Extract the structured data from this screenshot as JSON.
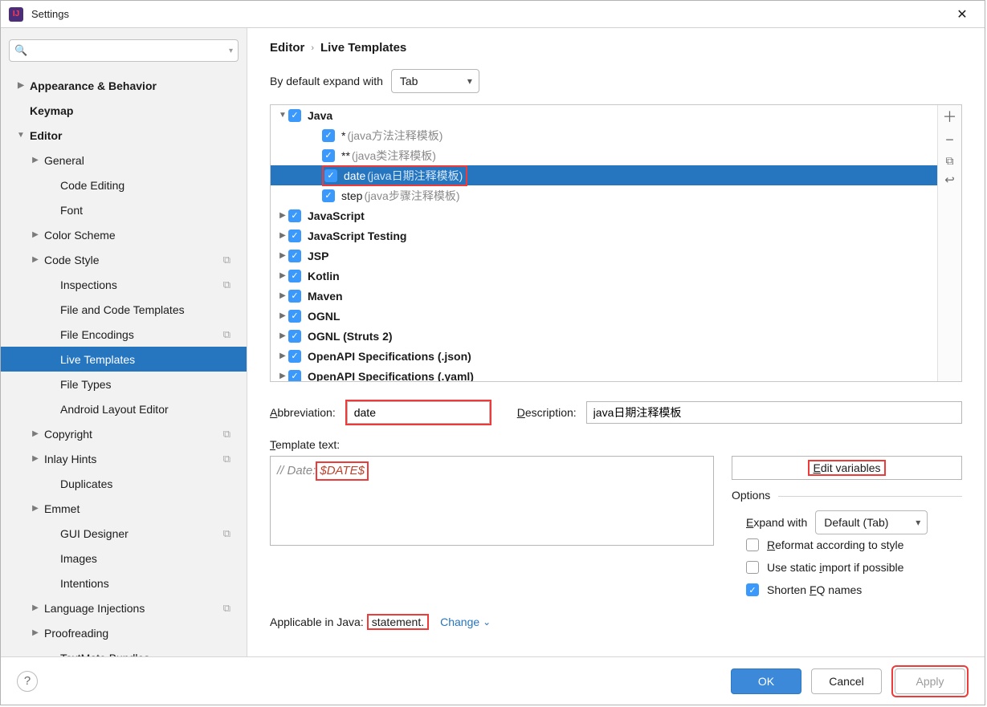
{
  "window": {
    "title": "Settings"
  },
  "search": {
    "placeholder": ""
  },
  "sidebar": {
    "items": [
      {
        "label": "Appearance & Behavior",
        "bold": true,
        "arrow": "▶",
        "ind": 0
      },
      {
        "label": "Keymap",
        "bold": true,
        "arrow": "",
        "ind": 0
      },
      {
        "label": "Editor",
        "bold": true,
        "arrow": "▼",
        "ind": 0
      },
      {
        "label": "General",
        "arrow": "▶",
        "ind": 1
      },
      {
        "label": "Code Editing",
        "arrow": "",
        "ind": 2
      },
      {
        "label": "Font",
        "arrow": "",
        "ind": 2
      },
      {
        "label": "Color Scheme",
        "arrow": "▶",
        "ind": 1
      },
      {
        "label": "Code Style",
        "arrow": "▶",
        "ind": 1,
        "copy": true
      },
      {
        "label": "Inspections",
        "arrow": "",
        "ind": 2,
        "copy": true
      },
      {
        "label": "File and Code Templates",
        "arrow": "",
        "ind": 2
      },
      {
        "label": "File Encodings",
        "arrow": "",
        "ind": 2,
        "copy": true
      },
      {
        "label": "Live Templates",
        "arrow": "",
        "ind": 2,
        "selected": true
      },
      {
        "label": "File Types",
        "arrow": "",
        "ind": 2
      },
      {
        "label": "Android Layout Editor",
        "arrow": "",
        "ind": 2
      },
      {
        "label": "Copyright",
        "arrow": "▶",
        "ind": 1,
        "copy": true
      },
      {
        "label": "Inlay Hints",
        "arrow": "▶",
        "ind": 1,
        "copy": true
      },
      {
        "label": "Duplicates",
        "arrow": "",
        "ind": 2
      },
      {
        "label": "Emmet",
        "arrow": "▶",
        "ind": 1
      },
      {
        "label": "GUI Designer",
        "arrow": "",
        "ind": 2,
        "copy": true
      },
      {
        "label": "Images",
        "arrow": "",
        "ind": 2
      },
      {
        "label": "Intentions",
        "arrow": "",
        "ind": 2
      },
      {
        "label": "Language Injections",
        "arrow": "▶",
        "ind": 1,
        "copy": true
      },
      {
        "label": "Proofreading",
        "arrow": "▶",
        "ind": 1
      },
      {
        "label": "TextMate Bundles",
        "arrow": "",
        "ind": 2
      }
    ]
  },
  "breadcrumb": {
    "a": "Editor",
    "b": "Live Templates"
  },
  "default_expand": {
    "label": "By default expand with",
    "value": "Tab"
  },
  "template_tree": [
    {
      "ind": 0,
      "arrow": "▼",
      "check": true,
      "label": "Java",
      "bold": true
    },
    {
      "ind": 2,
      "arrow": "",
      "check": true,
      "label": "*",
      "desc": "(java方法注释模板)"
    },
    {
      "ind": 2,
      "arrow": "",
      "check": true,
      "label": "**",
      "desc": "(java类注释模板)"
    },
    {
      "ind": 2,
      "arrow": "",
      "check": true,
      "label": "date",
      "desc": "(java日期注释模板)",
      "selected": true,
      "red": true
    },
    {
      "ind": 2,
      "arrow": "",
      "check": true,
      "label": "step",
      "desc": "(java步骤注释模板)"
    },
    {
      "ind": 0,
      "arrow": "▶",
      "check": true,
      "label": "JavaScript",
      "bold": true
    },
    {
      "ind": 0,
      "arrow": "▶",
      "check": true,
      "label": "JavaScript Testing",
      "bold": true
    },
    {
      "ind": 0,
      "arrow": "▶",
      "check": true,
      "label": "JSP",
      "bold": true
    },
    {
      "ind": 0,
      "arrow": "▶",
      "check": true,
      "label": "Kotlin",
      "bold": true
    },
    {
      "ind": 0,
      "arrow": "▶",
      "check": true,
      "label": "Maven",
      "bold": true
    },
    {
      "ind": 0,
      "arrow": "▶",
      "check": true,
      "label": "OGNL",
      "bold": true
    },
    {
      "ind": 0,
      "arrow": "▶",
      "check": true,
      "label": "OGNL (Struts 2)",
      "bold": true
    },
    {
      "ind": 0,
      "arrow": "▶",
      "check": true,
      "label": "OpenAPI Specifications (.json)",
      "bold": true
    },
    {
      "ind": 0,
      "arrow": "▶",
      "check": true,
      "label": "OpenAPI Specifications (.yaml)",
      "bold": true
    }
  ],
  "form": {
    "abbrev_label_pre": "A",
    "abbrev_label": "bbreviation:",
    "abbrev_value": "date",
    "desc_label_pre": "D",
    "desc_label": "escription:",
    "desc_value": "java日期注释模板",
    "tt_label_pre": "T",
    "tt_label": "emplate text:",
    "tt_prefix": "// Date:",
    "tt_var": "$DATE$",
    "edit_vars_pre": "E",
    "edit_vars": "dit variables",
    "opts_legend": "Options",
    "expand_with_pre": "E",
    "expand_with": "xpand with",
    "expand_with_value": "Default (Tab)",
    "reformat_pre": "R",
    "reformat": "eformat according to style",
    "staticimp": "Use static ",
    "staticimp_ul": "i",
    "staticimp_post": "mport if possible",
    "shorten": "Shorten ",
    "shorten_ul": "F",
    "shorten_post": "Q names",
    "applicable_pre": "Applicable in Java:",
    "applicable_val": " statement.",
    "change": "Change"
  },
  "footer": {
    "ok": "OK",
    "cancel": "Cancel",
    "apply": "Apply"
  }
}
